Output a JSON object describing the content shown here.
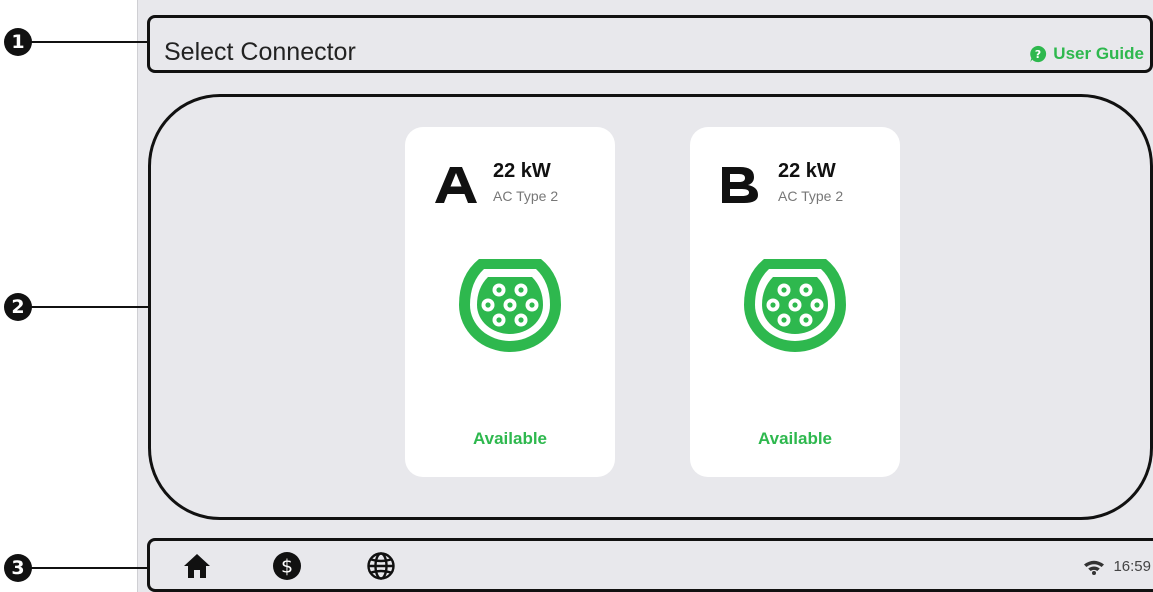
{
  "callouts": [
    "1",
    "2",
    "3"
  ],
  "header": {
    "title": "Select Connector",
    "guide_label": "User Guide"
  },
  "connectors": [
    {
      "letter": "A",
      "power": "22 kW",
      "type": "AC Type 2",
      "status": "Available"
    },
    {
      "letter": "B",
      "power": "22 kW",
      "type": "AC Type 2",
      "status": "Available"
    }
  ],
  "footer": {
    "nav_icons": [
      "home-icon",
      "dollar-icon",
      "globe-icon"
    ],
    "time": "16:59"
  },
  "colors": {
    "accent": "#2eb84e",
    "background": "#e8e8ec",
    "card": "#ffffff"
  }
}
